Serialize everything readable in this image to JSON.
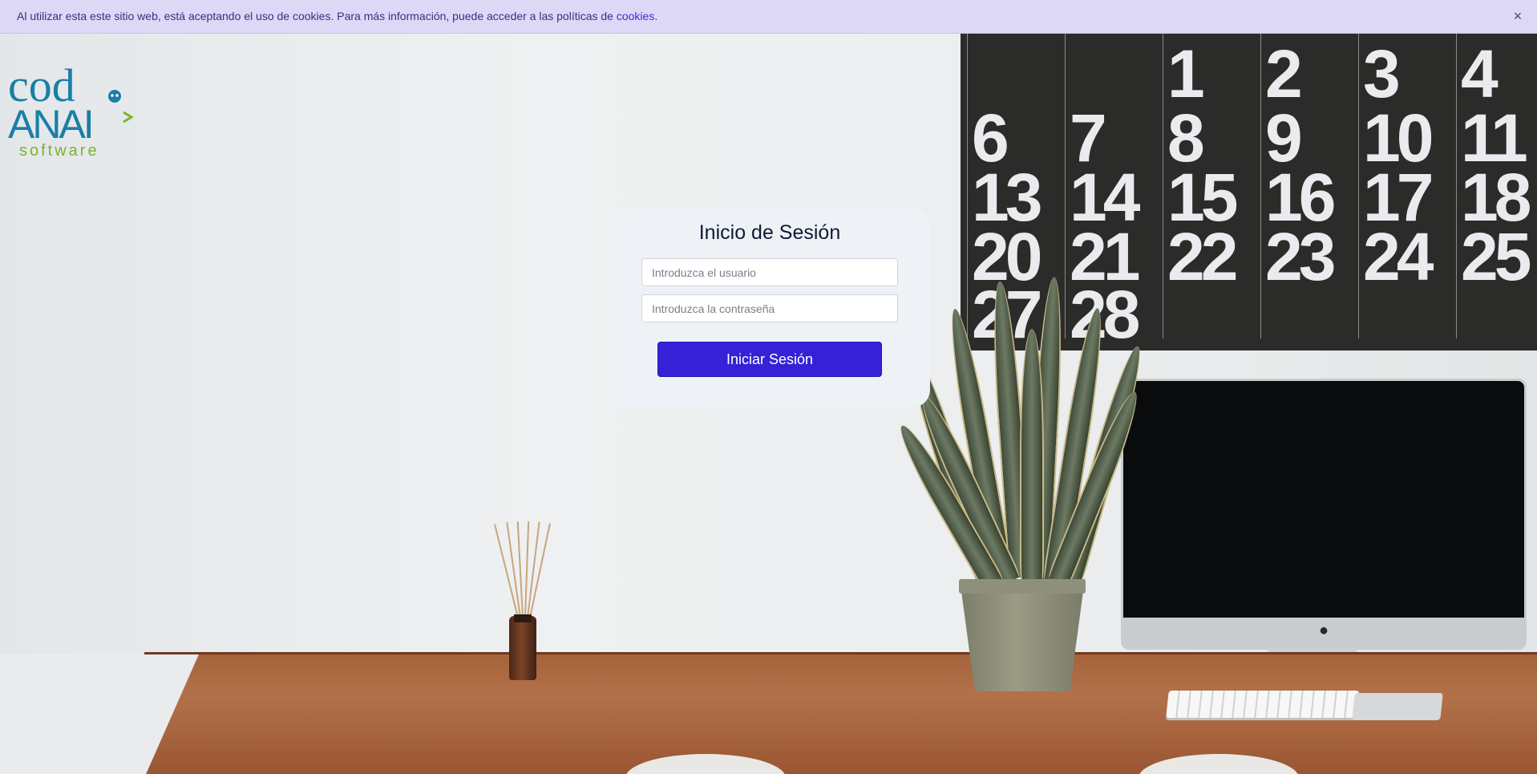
{
  "cookie_bar": {
    "text": "Al utilizar esta este sitio web, está aceptando el uso de cookies. Para más información, puede acceder a las políticas de ",
    "link_text": "cookies",
    "suffix": ".",
    "close_label": "×"
  },
  "logo": {
    "top_text": "cod",
    "middle_text": "ANAI",
    "bottom_text": "software",
    "primary_color": "#1a7fa6",
    "accent_color": "#7bb52a"
  },
  "calendar": {
    "rows": [
      [
        "",
        "",
        "1",
        "2",
        "3",
        "4"
      ],
      [
        "6",
        "7",
        "8",
        "9",
        "10",
        "11"
      ],
      [
        "13",
        "14",
        "15",
        "16",
        "17",
        "18"
      ],
      [
        "20",
        "21",
        "22",
        "23",
        "24",
        "25"
      ],
      [
        "27",
        "28",
        "",
        "",
        "",
        ""
      ]
    ]
  },
  "login": {
    "title": "Inicio de Sesión",
    "username_placeholder": "Introduzca el usuario",
    "password_placeholder": "Introduzca la contraseña",
    "submit_label": "Iniciar Sesión"
  },
  "colors": {
    "cookie_bg": "#dcd8f6",
    "button_bg": "#3621d7",
    "card_bg": "#eef2f6"
  }
}
